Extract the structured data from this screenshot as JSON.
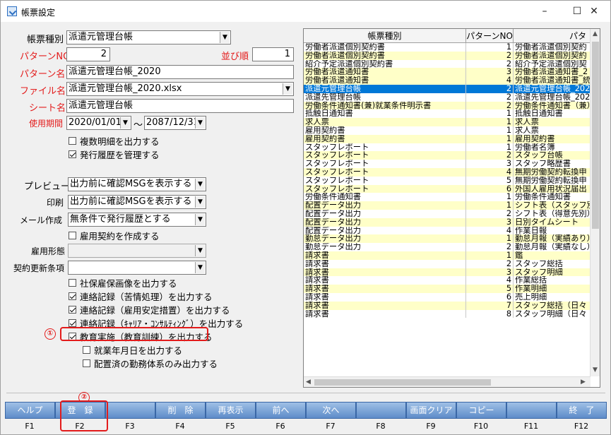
{
  "window": {
    "title": "帳票設定",
    "minimize": "–",
    "maximize": "☐",
    "close": "✕"
  },
  "form": {
    "form_type_label": "帳票種別",
    "form_type_value": "派遣元管理台帳",
    "pattern_no_label": "パターンNO",
    "pattern_no_value": "2",
    "order_label": "並び順",
    "order_value": "1",
    "pattern_name_label": "パターン名",
    "pattern_name_value": "派遣元管理台帳_2020",
    "file_name_label": "ファイル名",
    "file_name_value": "派遣元管理台帳_2020.xlsx",
    "sheet_name_label": "シート名",
    "sheet_name_value": "派遣元管理台帳",
    "period_label": "使用期間",
    "period_from": "2020/01/01",
    "period_tilde": "～",
    "period_to": "2087/12/31",
    "preview_label": "プレビュー",
    "preview_value": "出力前に確認MSGを表示する",
    "print_label": "印刷",
    "print_value": "出力前に確認MSGを表示する",
    "mail_label": "メール作成",
    "mail_value": "無条件で発行履歴とする",
    "employment_label": "雇用形態",
    "employment_value": "",
    "contract_label": "契約更新条項",
    "contract_value": ""
  },
  "checkboxes": [
    {
      "label": "複数明細を出力する",
      "checked": false
    },
    {
      "label": "発行履歴を管理する",
      "checked": true
    },
    {
      "label": "雇用契約を作成する",
      "checked": false
    },
    {
      "label": "社保雇保画像を出力する",
      "checked": false
    },
    {
      "label": "連絡記録（苦情処理）を出力する",
      "checked": true
    },
    {
      "label": "連絡記録（雇用安定措置）を出力する",
      "checked": true
    },
    {
      "label": "連絡記録（ｷｬﾘｱ・ｺﾝｻﾙﾃｨﾝｸﾞ）を出力する",
      "checked": true
    },
    {
      "label": "教育実施（教育訓練）を出力する",
      "checked": true
    },
    {
      "label": "就業年月日を出力する",
      "checked": false
    },
    {
      "label": "配置済の勤務体系のみ出力する",
      "checked": false
    }
  ],
  "annotations": {
    "one": "①",
    "two": "②"
  },
  "grid": {
    "headers": [
      "帳票種別",
      "パターンNO",
      "パタ"
    ],
    "rows": [
      [
        "労働者派遣個別契約書",
        "1",
        "労働者派遣個別契約"
      ],
      [
        "労働者派遣個別契約書",
        "2",
        "労働者派遣個別契約"
      ],
      [
        "紹介予定派遣個別契約書",
        "2",
        "紹介予定派遣個別契"
      ],
      [
        "労働者派遣通知書",
        "3",
        "労働者派遣通知書_2"
      ],
      [
        "労働者派遣通知書",
        "4",
        "労働者派遣通知書_統"
      ],
      [
        "派遣元管理台帳",
        "2",
        "派遣元管理台帳_202"
      ],
      [
        "派遣先管理台帳",
        "2",
        "派遣先管理台帳_202"
      ],
      [
        "労働条件通知書(兼)就業条件明示書",
        "2",
        "労働条件通知書（兼）"
      ],
      [
        "抵触日通知書",
        "1",
        "抵触日通知書"
      ],
      [
        "求人票",
        "1",
        "求人票"
      ],
      [
        "雇用契約書",
        "1",
        "求人票"
      ],
      [
        "雇用契約書",
        "1",
        "雇用契約書"
      ],
      [
        "スタッフレポート",
        "1",
        "労働者名簿"
      ],
      [
        "スタッフレポート",
        "2",
        "スタッフ台帳"
      ],
      [
        "スタッフレポート",
        "3",
        "スタッフ略歴書"
      ],
      [
        "スタッフレポート",
        "4",
        "無期労働契約転換申"
      ],
      [
        "スタッフレポート",
        "5",
        "無期労働契約転換申"
      ],
      [
        "スタッフレポート",
        "6",
        "外国人雇用状況届出"
      ],
      [
        "労働条件通知書",
        "1",
        "労働条件通知書"
      ],
      [
        "配置データ出力",
        "1",
        "シフト表（スタッフ別"
      ],
      [
        "配置データ出力",
        "2",
        "シフト表（得意先別）"
      ],
      [
        "配置データ出力",
        "3",
        "日別タイムシート"
      ],
      [
        "配置データ出力",
        "4",
        "作業日報"
      ],
      [
        "勤怠データ出力",
        "1",
        "勤怠月報（実績あり）"
      ],
      [
        "勤怠データ出力",
        "2",
        "勤怠月報（実績なし）"
      ],
      [
        "請求書",
        "1",
        "鑑"
      ],
      [
        "請求書",
        "2",
        "スタッフ総括"
      ],
      [
        "請求書",
        "3",
        "スタッフ明細"
      ],
      [
        "請求書",
        "4",
        "作業総括"
      ],
      [
        "請求書",
        "5",
        "作業明細"
      ],
      [
        "請求書",
        "6",
        "売上明細"
      ],
      [
        "請求書",
        "7",
        "スタッフ総括（日々"
      ],
      [
        "請求書",
        "8",
        "スタッフ明細（日々"
      ]
    ],
    "selected_index": 5
  },
  "fkeys": [
    {
      "label": "ヘルプ",
      "key": "F1"
    },
    {
      "label": "登　録",
      "key": "F2"
    },
    {
      "label": "",
      "key": "F3"
    },
    {
      "label": "削　除",
      "key": "F4"
    },
    {
      "label": "再表示",
      "key": "F5"
    },
    {
      "label": "前へ",
      "key": "F6"
    },
    {
      "label": "次へ",
      "key": "F7"
    },
    {
      "label": "",
      "key": "F8"
    },
    {
      "label": "画面クリア",
      "key": "F9"
    },
    {
      "label": "コピー",
      "key": "F10"
    },
    {
      "label": "",
      "key": "F11"
    },
    {
      "label": "終　了",
      "key": "F12"
    }
  ],
  "colors": {
    "accent_red": "#e31b1b",
    "selected_row": "#0078d7",
    "alt_row": "#ffffc8",
    "fkey_blue": "#5e8cc9"
  }
}
